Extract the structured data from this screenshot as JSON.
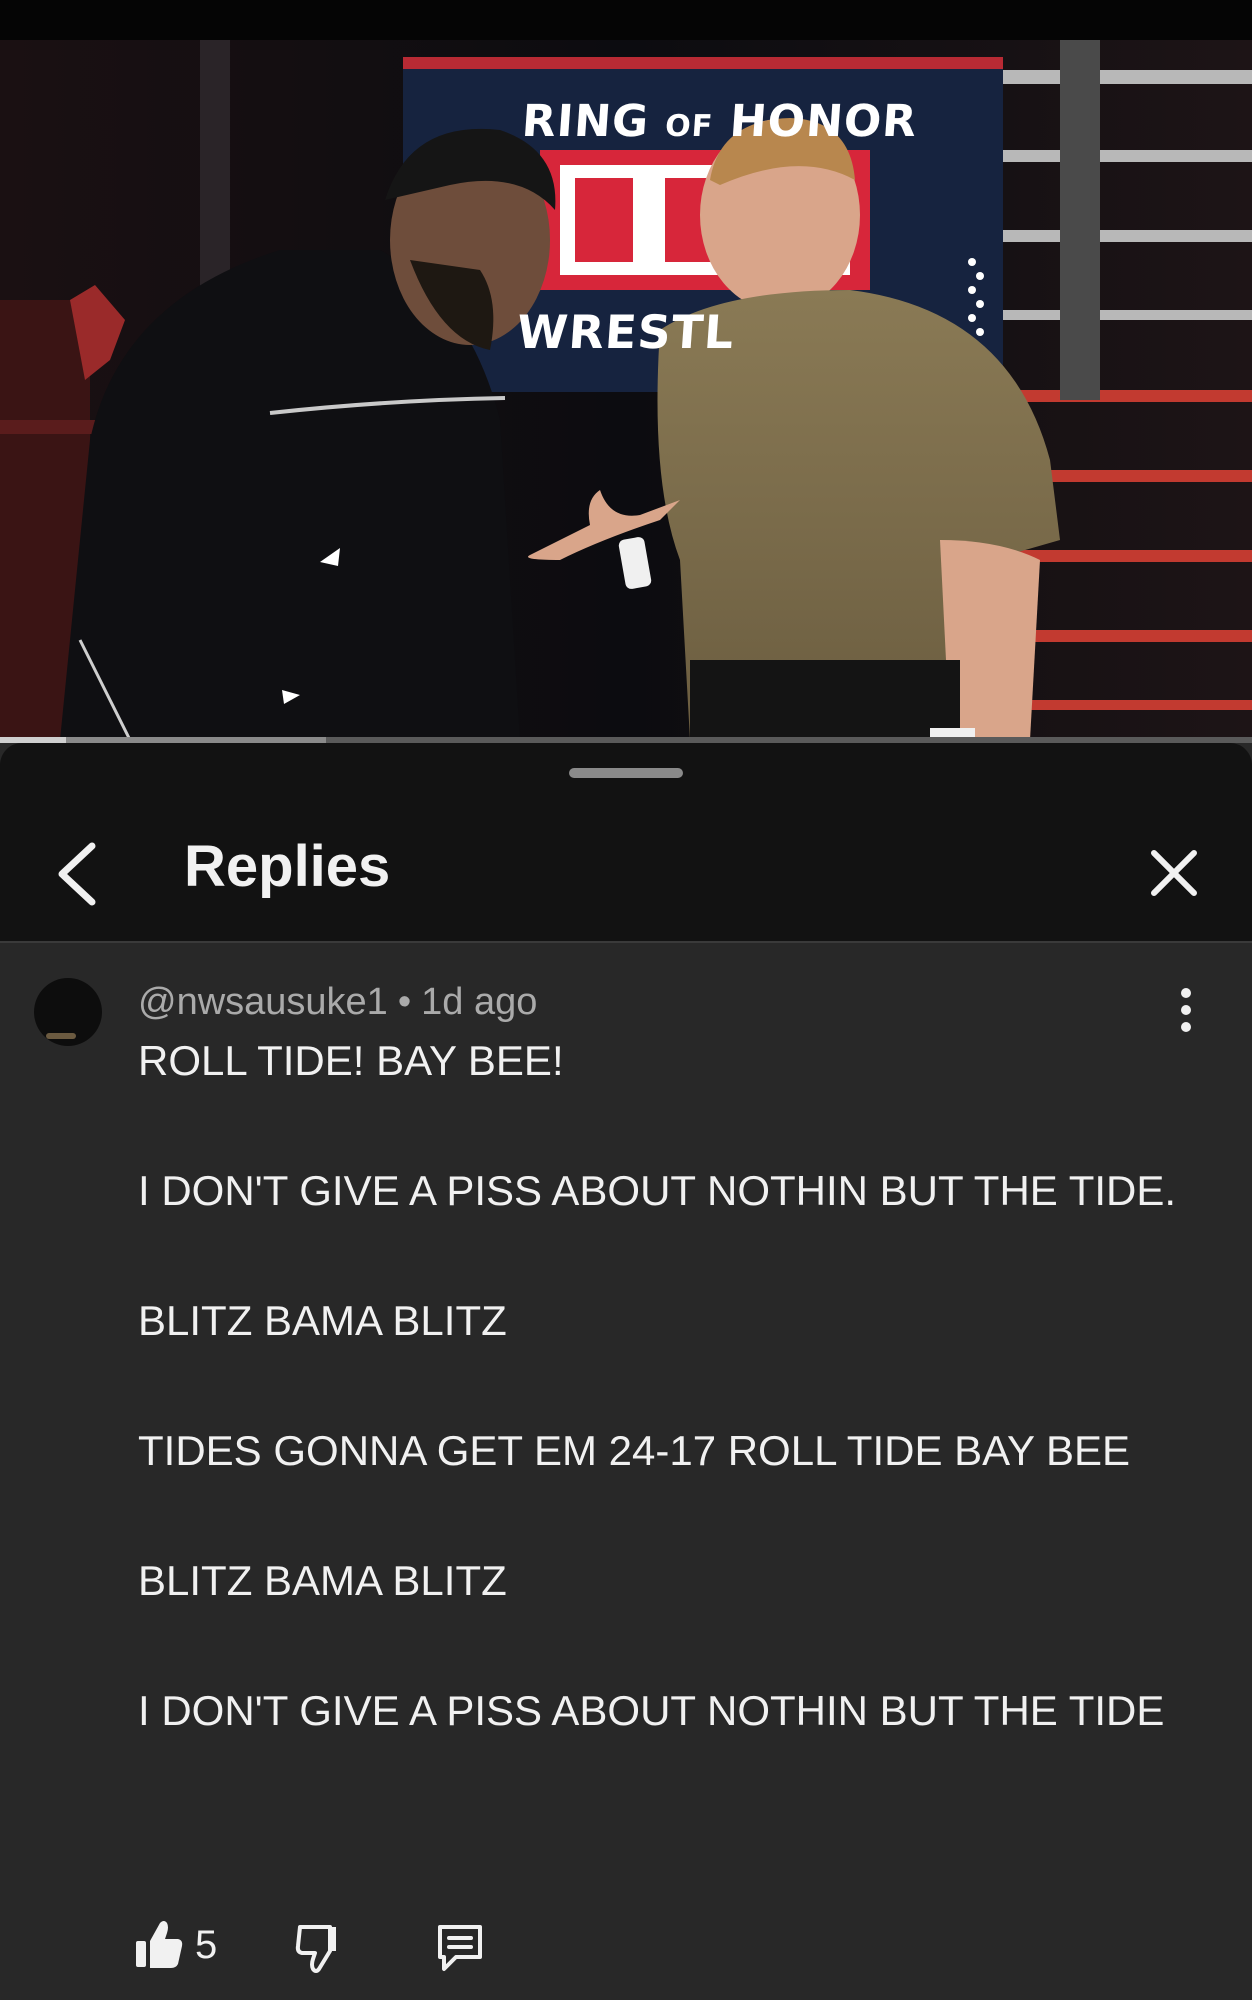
{
  "video": {
    "sign_line1_a": "RING",
    "sign_line1_b": "OF",
    "sign_line1_c": "HONOR",
    "sign_line3": "WRESTL",
    "sign_logo": "RO",
    "progress_fraction": 0.053,
    "buffer_fraction": 0.26
  },
  "header": {
    "title": "Replies",
    "back_icon": "chevron-left-icon",
    "close_icon": "close-icon"
  },
  "comment": {
    "author": "@nwsausuke1",
    "separator": "•",
    "time": "1d ago",
    "lines": [
      "ROLL TIDE! BAY BEE!",
      "I DON'T GIVE A PISS ABOUT NOTHIN BUT THE TIDE.",
      "BLITZ BAMA BLITZ",
      "TIDES GONNA GET EM 24-17 ROLL TIDE BAY BEE",
      "BLITZ BAMA BLITZ",
      "I DON'T GIVE A PISS ABOUT NOTHIN BUT THE TIDE"
    ],
    "more_icon": "more-vertical-icon"
  },
  "actions": {
    "like_count": "5",
    "like_icon": "thumbs-up-filled-icon",
    "dislike_icon": "thumbs-down-icon",
    "reply_icon": "reply-comment-icon"
  },
  "colors": {
    "sheet_bg": "#282828",
    "header_bg": "#121212",
    "text_primary": "#f1f1f1",
    "text_secondary": "#aaaaaa"
  }
}
